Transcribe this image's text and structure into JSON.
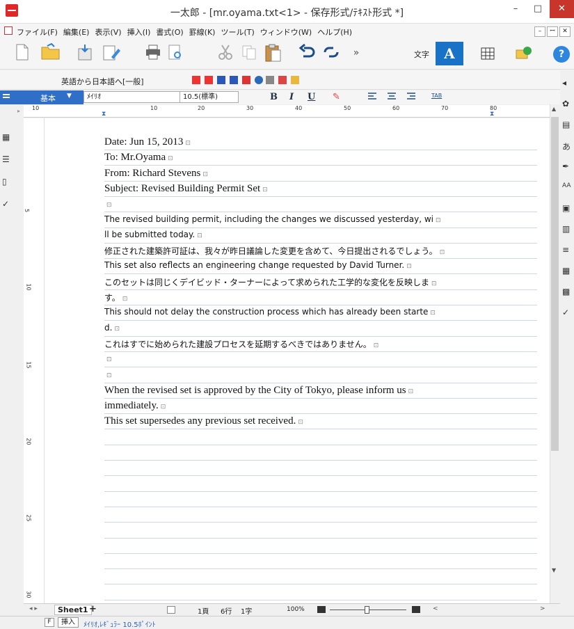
{
  "window": {
    "title": "一太郎 - [mr.oyama.txt<1> - 保存形式/ﾃｷｽﾄ形式 *]",
    "minimize": "–",
    "maximize": "□",
    "close": "✕"
  },
  "menu": {
    "items": [
      "ファイル(F)",
      "編集(E)",
      "表示(V)",
      "挿入(I)",
      "書式(O)",
      "罫線(K)",
      "ツール(T)",
      "ウィンドウ(W)",
      "ヘルプ(H)"
    ],
    "mdi_min": "–",
    "mdi_restore": "ꟷ",
    "mdi_close": "✕"
  },
  "toolbar": {
    "char_label": "文字",
    "font_toggle": "A",
    "more": "»",
    "help": "?"
  },
  "translate": {
    "label": "英語から日本語へ[一般]"
  },
  "stylebar": {
    "style": "基本",
    "font": "ﾒｲﾘｵ",
    "size": "10.5(標準)",
    "bold": "B",
    "italic": "I",
    "underline": "U",
    "tab": "TAB"
  },
  "ruler": {
    "numbers": [
      "10",
      "10",
      "20",
      "30",
      "40",
      "50",
      "60",
      "70",
      "80"
    ]
  },
  "vruler": {
    "numbers": [
      "5",
      "10",
      "15",
      "20",
      "25",
      "30"
    ]
  },
  "document": {
    "lines": [
      {
        "text": "Date: Jun 15, 2013",
        "style": "serif"
      },
      {
        "text": "To: Mr.Oyama",
        "style": "serif"
      },
      {
        "text": "From: Richard Stevens",
        "style": "serif"
      },
      {
        "text": "Subject: Revised Building Permit Set",
        "style": "serif"
      },
      {
        "text": "",
        "style": "serif"
      },
      {
        "text": "The revised building permit, including the changes we discussed yesterday, wi",
        "style": "sans"
      },
      {
        "text": "ll be submitted today.",
        "style": "sans"
      },
      {
        "text": "修正された建築許可証は、我々が昨日議論した変更を含めて、今日提出されるでしょう。",
        "style": "sans"
      },
      {
        "text": "This set also reflects an engineering change requested by David Turner.",
        "style": "sans"
      },
      {
        "text": "このセットは同じくデイビッド・ターナーによって求められた工学的な変化を反映しま",
        "style": "sans"
      },
      {
        "text": "す。",
        "style": "sans"
      },
      {
        "text": "This should not delay the construction process which has already been starte",
        "style": "sans"
      },
      {
        "text": "d.",
        "style": "sans"
      },
      {
        "text": "これはすでに始められた建設プロセスを延期するべきではありません。",
        "style": "sans"
      },
      {
        "text": "",
        "style": "sans"
      },
      {
        "text": "",
        "style": "sans"
      },
      {
        "text": "When the revised set is approved by the City of Tokyo, please inform us",
        "style": "serif"
      },
      {
        "text": "immediately.",
        "style": "serif"
      },
      {
        "text": "This set supersedes any previous set received.",
        "style": "serif"
      }
    ]
  },
  "sheetbar": {
    "sheet": "Sheet1",
    "add": "+",
    "page": "1頁",
    "line": "6行",
    "col": "1字",
    "zoom": "100%"
  },
  "status": {
    "key": "F",
    "mode": "挿入",
    "font": "ﾒｲﾘｵ,ﾚｷﾞｭﾗｰ 10.5ﾎﾟｲﾝﾄ"
  }
}
